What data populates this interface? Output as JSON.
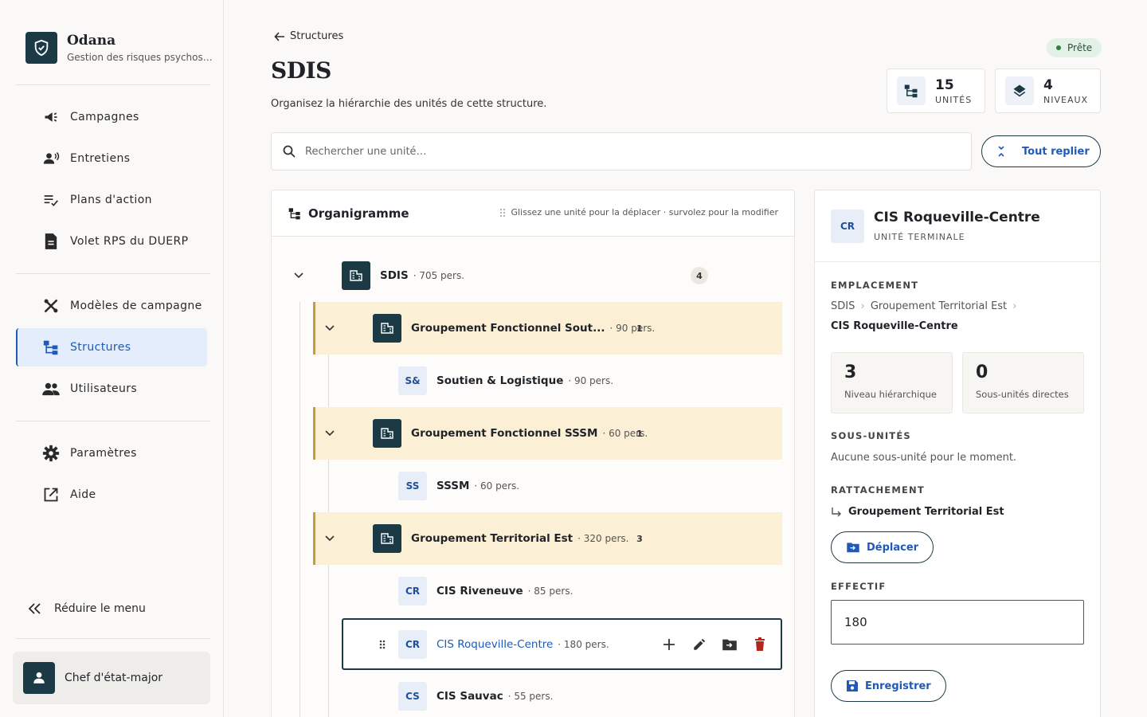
{
  "brand": {
    "name": "Odana",
    "subtitle": "Gestion des risques psychos…"
  },
  "sidebar": {
    "items": [
      {
        "label": "Campagnes",
        "icon": "megaphone-icon"
      },
      {
        "label": "Entretiens",
        "icon": "interview-icon"
      },
      {
        "label": "Plans d'action",
        "icon": "checklist-icon"
      },
      {
        "label": "Volet RPS du DUERP",
        "icon": "document-icon"
      },
      {
        "label": "Modèles de campagne",
        "icon": "tools-icon"
      },
      {
        "label": "Structures",
        "icon": "hierarchy-icon",
        "active": true
      },
      {
        "label": "Utilisateurs",
        "icon": "users-icon"
      },
      {
        "label": "Paramètres",
        "icon": "gear-icon"
      },
      {
        "label": "Aide",
        "icon": "external-link-icon"
      }
    ],
    "collapse_label": "Réduire le menu",
    "user_name": "Chef d'état-major"
  },
  "header": {
    "back_label": "Structures",
    "title": "SDIS",
    "description": "Organisez la hiérarchie des unités de cette structure.",
    "status": "Prête",
    "stats": [
      {
        "value": "15",
        "label": "UNITÉS"
      },
      {
        "value": "4",
        "label": "NIVEAUX"
      }
    ]
  },
  "search": {
    "placeholder": "Rechercher une unité…"
  },
  "collapse_all_label": "Tout replier",
  "tree": {
    "title": "Organigramme",
    "hint": "Glissez une unité pour la déplacer · survolez pour la modifier",
    "nodes": [
      {
        "name": "SDIS",
        "count": "· 705 pers.",
        "badge": "4"
      },
      {
        "name": "Groupement Fonctionnel Sout...",
        "count": "· 90 pers.",
        "badge": "1"
      },
      {
        "abbr": "S&",
        "name": "Soutien & Logistique",
        "count": "· 90 pers."
      },
      {
        "name": "Groupement Fonctionnel SSSM",
        "count": "· 60 pers.",
        "badge": "1"
      },
      {
        "abbr": "SS",
        "name": "SSSM",
        "count": "· 60 pers."
      },
      {
        "name": "Groupement Territorial Est",
        "count": "· 320 pers.",
        "badge": "3"
      },
      {
        "abbr": "CR",
        "name": "CIS Riveneuve",
        "count": "· 85 pers."
      },
      {
        "abbr": "CR",
        "name": "CIS Roqueville-Centre",
        "count": "· 180 pers."
      },
      {
        "abbr": "CS",
        "name": "CIS Sauvac",
        "count": "· 55 pers."
      }
    ]
  },
  "detail": {
    "abbr": "CR",
    "title": "CIS Roqueville-Centre",
    "subtitle": "UNITÉ TERMINALE",
    "location_label": "EMPLACEMENT",
    "crumbs": [
      "SDIS",
      "Groupement Territorial Est"
    ],
    "current": "CIS Roqueville-Centre",
    "level_value": "3",
    "level_label": "Niveau hiérarchique",
    "sub_value": "0",
    "sub_label": "Sous-unités directes",
    "subunits_label": "SOUS-UNITÉS",
    "subunits_empty": "Aucune sous-unité pour le moment.",
    "attach_label": "RATTACHEMENT",
    "attach_value": "Groupement Territorial Est",
    "move_label": "Déplacer",
    "effectif_label": "EFFECTIF",
    "effectif_value": "180",
    "save_label": "Enregistrer"
  }
}
